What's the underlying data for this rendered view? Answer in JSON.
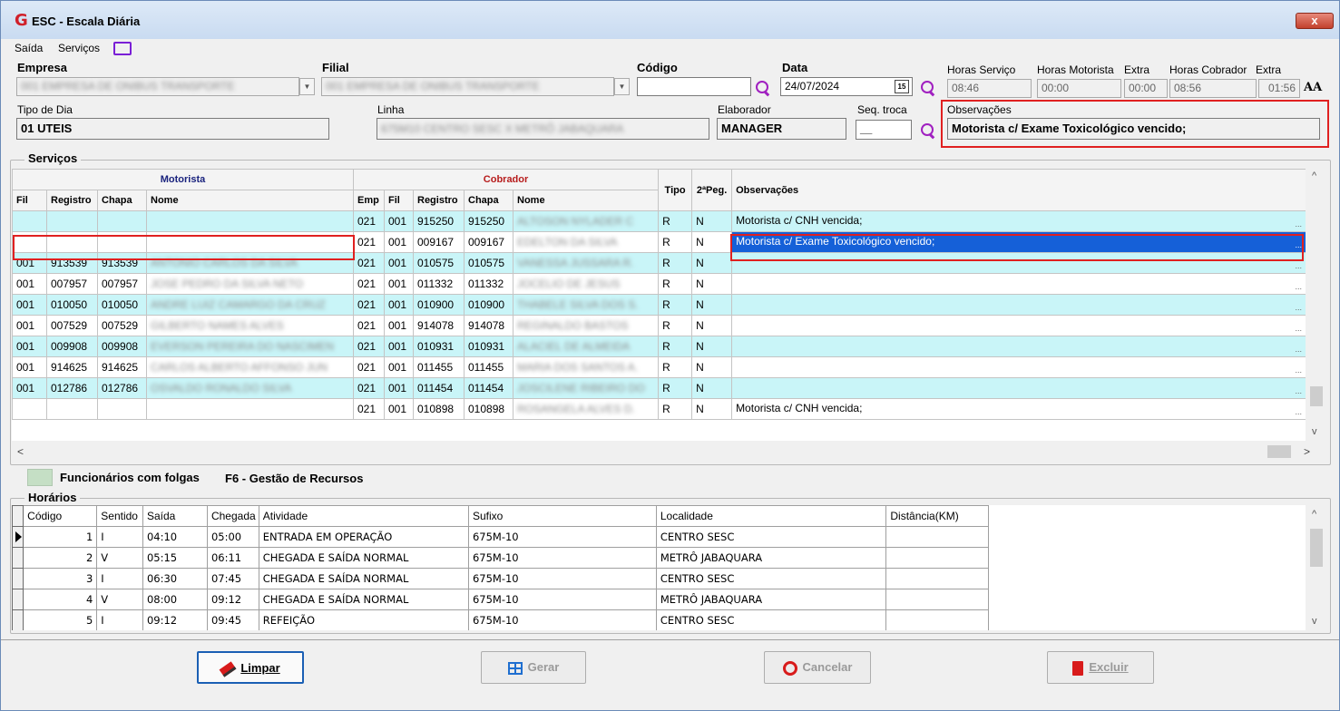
{
  "window": {
    "title": "ESC - Escala Diária",
    "close_label": "x"
  },
  "menu": {
    "saida": "Saída",
    "servicos": "Serviços"
  },
  "header": {
    "empresa_label": "Empresa",
    "empresa_value": "001 EMPRESA DE ONIBUS TRANSPORTE",
    "filial_label": "Filial",
    "filial_value": "001 EMPRESA DE ONIBUS TRANSPORTE",
    "codigo_label": "Código",
    "codigo_value": "",
    "data_label": "Data",
    "data_value": "24/07/2024",
    "horas_servico_label": "Horas Serviço",
    "horas_servico_value": "08:46",
    "horas_motorista_label": "Horas Motorista",
    "horas_motorista_value": "00:00",
    "extra1_label": "Extra",
    "extra1_value": "00:00",
    "horas_cobrador_label": "Horas Cobrador",
    "horas_cobrador_value": "08:56",
    "extra2_label": "Extra",
    "extra2_value": "01:56",
    "font_icon": "AA",
    "tipo_dia_label": "Tipo de Dia",
    "tipo_dia_value": "01 UTEIS",
    "linha_label": "Linha",
    "linha_value": "675M10 CENTRO SESC X METRÔ JABAQUARA",
    "elaborador_label": "Elaborador",
    "elaborador_value": "MANAGER",
    "seq_troca_label": "Seq. troca",
    "seq_troca_value": "__",
    "observacoes_label": "Observações",
    "observacoes_value": "Motorista c/ Exame Toxicológico vencido;"
  },
  "servicos": {
    "group_label": "Serviços",
    "motorista_header": "Motorista",
    "cobrador_header": "Cobrador",
    "columns": {
      "fil": "Fil",
      "registro": "Registro",
      "chapa": "Chapa",
      "nome": "Nome",
      "emp": "Emp",
      "fil2": "Fil",
      "registro2": "Registro",
      "chapa2": "Chapa",
      "nome2": "Nome",
      "tipo": "Tipo",
      "peg": "2ªPeg.",
      "obs": "Observações"
    },
    "ellipsis": "...",
    "rows": [
      {
        "fil": "",
        "reg": "",
        "chapa": "",
        "nome": "",
        "emp": "021",
        "fil2": "001",
        "reg2": "915250",
        "chapa2": "915250",
        "nome2": "ALTOSON NYLADER C",
        "tipo": "R",
        "peg": "N",
        "obs": "Motorista c/ CNH vencida;"
      },
      {
        "fil": "",
        "reg": "",
        "chapa": "",
        "nome": "",
        "emp": "021",
        "fil2": "001",
        "reg2": "009167",
        "chapa2": "009167",
        "nome2": "EDELTON DA SILVA",
        "tipo": "R",
        "peg": "N",
        "obs": "Motorista c/ Exame Toxicológico vencido;"
      },
      {
        "fil": "001",
        "reg": "913539",
        "chapa": "913539",
        "nome": "ANTONIO CARLOS DA SILVA",
        "emp": "021",
        "fil2": "001",
        "reg2": "010575",
        "chapa2": "010575",
        "nome2": "VANESSA JUSSARA R.",
        "tipo": "R",
        "peg": "N",
        "obs": ""
      },
      {
        "fil": "001",
        "reg": "007957",
        "chapa": "007957",
        "nome": "JOSE PEDRO DA SILVA NETO",
        "emp": "021",
        "fil2": "001",
        "reg2": "011332",
        "chapa2": "011332",
        "nome2": "JOCELIO DE JESUS",
        "tipo": "R",
        "peg": "N",
        "obs": ""
      },
      {
        "fil": "001",
        "reg": "010050",
        "chapa": "010050",
        "nome": "ANDRE LUIZ CAMARGO DA CRUZ",
        "emp": "021",
        "fil2": "001",
        "reg2": "010900",
        "chapa2": "010900",
        "nome2": "THABELE SILVA DOS S.",
        "tipo": "R",
        "peg": "N",
        "obs": ""
      },
      {
        "fil": "001",
        "reg": "007529",
        "chapa": "007529",
        "nome": "GILBERTO NAMES ALVES",
        "emp": "021",
        "fil2": "001",
        "reg2": "914078",
        "chapa2": "914078",
        "nome2": "REGINALDO BASTOS",
        "tipo": "R",
        "peg": "N",
        "obs": ""
      },
      {
        "fil": "001",
        "reg": "009908",
        "chapa": "009908",
        "nome": "EVERSON PEREIRA DO NASCIMEN",
        "emp": "021",
        "fil2": "001",
        "reg2": "010931",
        "chapa2": "010931",
        "nome2": "ALACIEL DE ALMEIDA",
        "tipo": "R",
        "peg": "N",
        "obs": ""
      },
      {
        "fil": "001",
        "reg": "914625",
        "chapa": "914625",
        "nome": "CARLOS ALBERTO AFFONSO JUN",
        "emp": "021",
        "fil2": "001",
        "reg2": "011455",
        "chapa2": "011455",
        "nome2": "MARIA DOS SANTOS A.",
        "tipo": "R",
        "peg": "N",
        "obs": ""
      },
      {
        "fil": "001",
        "reg": "012786",
        "chapa": "012786",
        "nome": "OSVALDO RONALDO SILVA",
        "emp": "021",
        "fil2": "001",
        "reg2": "011454",
        "chapa2": "011454",
        "nome2": "JOSCILENE RIBEIRO DO",
        "tipo": "R",
        "peg": "N",
        "obs": ""
      },
      {
        "fil": "",
        "reg": "",
        "chapa": "",
        "nome": "",
        "emp": "021",
        "fil2": "001",
        "reg2": "010898",
        "chapa2": "010898",
        "nome2": "ROSANGELA ALVES D.",
        "tipo": "R",
        "peg": "N",
        "obs": "Motorista c/ CNH vencida;"
      }
    ]
  },
  "legend": {
    "folgas_label": "Funcionários com folgas",
    "f6_label": "F6 - Gestão de Recursos"
  },
  "horarios": {
    "group_label": "Horários",
    "columns": {
      "codigo": "Código",
      "sentido": "Sentido",
      "saida": "Saída",
      "chegada": "Chegada",
      "atividade": "Atividade",
      "sufixo": "Sufixo",
      "localidade": "Localidade",
      "distancia": "Distância(KM)"
    },
    "rows": [
      {
        "codigo": "1",
        "sentido": "I",
        "saida": "04:10",
        "chegada": "05:00",
        "atividade": "ENTRADA EM OPERAÇÃO",
        "sufixo": "675M-10",
        "localidade": "CENTRO SESC",
        "distancia": ""
      },
      {
        "codigo": "2",
        "sentido": "V",
        "saida": "05:15",
        "chegada": "06:11",
        "atividade": "CHEGADA E SAÍDA NORMAL",
        "sufixo": "675M-10",
        "localidade": "METRÔ JABAQUARA",
        "distancia": ""
      },
      {
        "codigo": "3",
        "sentido": "I",
        "saida": "06:30",
        "chegada": "07:45",
        "atividade": "CHEGADA E SAÍDA NORMAL",
        "sufixo": "675M-10",
        "localidade": "CENTRO SESC",
        "distancia": ""
      },
      {
        "codigo": "4",
        "sentido": "V",
        "saida": "08:00",
        "chegada": "09:12",
        "atividade": "CHEGADA E SAÍDA NORMAL",
        "sufixo": "675M-10",
        "localidade": "METRÔ JABAQUARA",
        "distancia": ""
      },
      {
        "codigo": "5",
        "sentido": "I",
        "saida": "09:12",
        "chegada": "09:45",
        "atividade": "REFEIÇÃO",
        "sufixo": "675M-10",
        "localidade": "CENTRO SESC",
        "distancia": ""
      }
    ]
  },
  "buttons": {
    "limpar": "Limpar",
    "gerar": "Gerar",
    "cancelar": "Cancelar",
    "excluir": "Excluir"
  },
  "colors": {
    "selection": "#1560d8",
    "cyan_row": "#c9f5f8",
    "highlight": "#e02020",
    "motorista_header": "#1a237e",
    "cobrador_header": "#b71c1c"
  }
}
